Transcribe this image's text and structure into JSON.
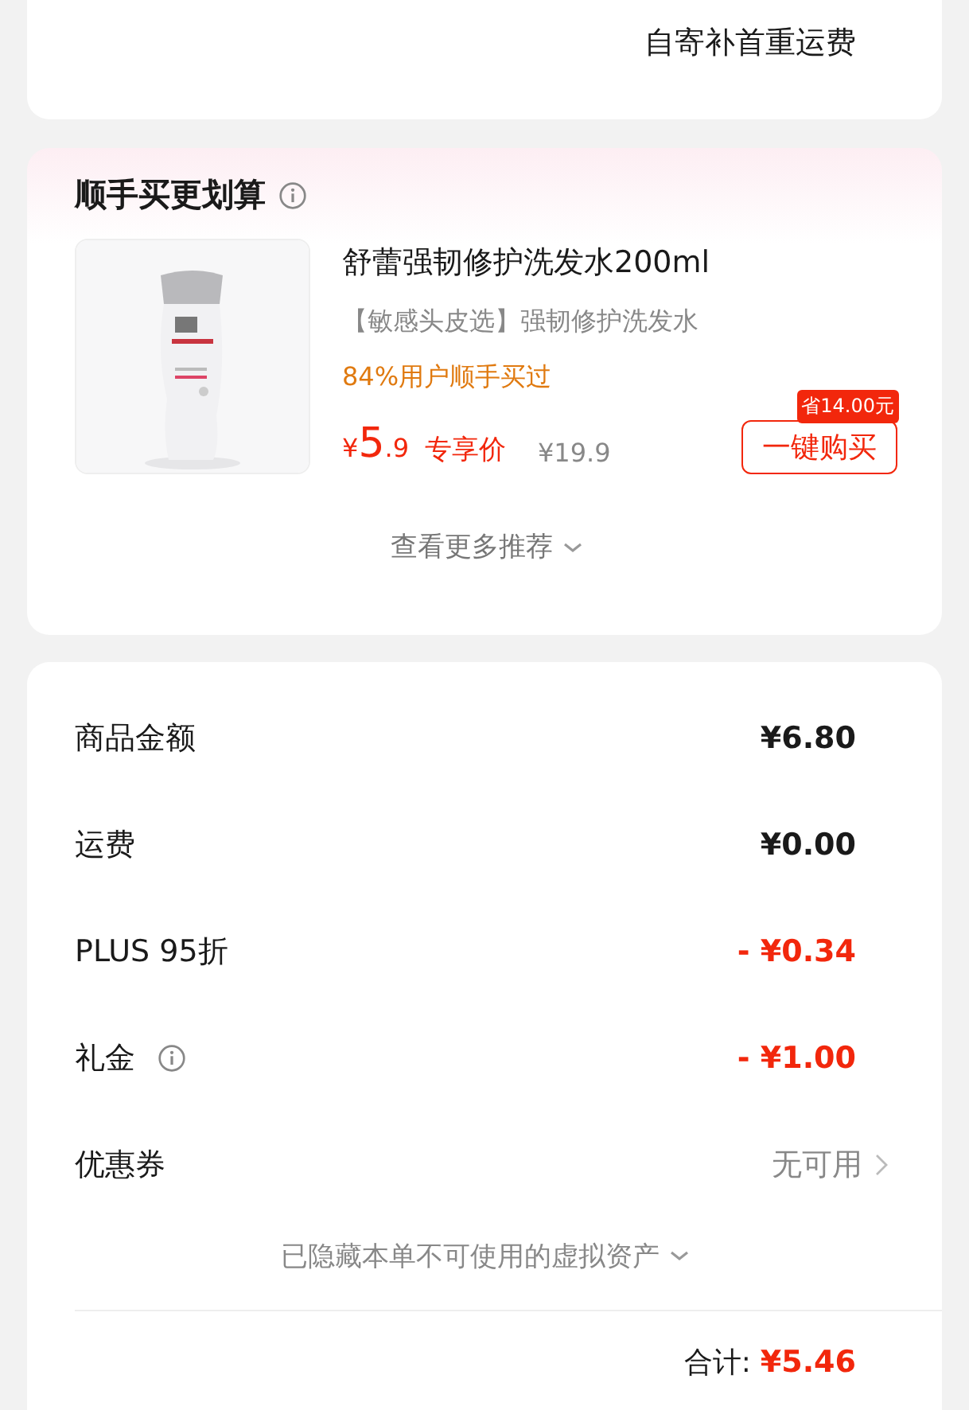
{
  "return_card": {
    "note": "自寄补首重运费"
  },
  "addon": {
    "title": "顺手买更划算",
    "info": true,
    "product": {
      "name": "舒蕾强韧修护洗发水200ml",
      "subtitle": "【敏感头皮选】强韧修护洗发水",
      "social": "84%用户顺手买过",
      "currency": "¥",
      "price_int": "5",
      "price_dec": ".9",
      "price_label": "专享价",
      "original_price": "¥19.9",
      "save_badge": "省14.00元",
      "buy_button": "一键购买"
    },
    "more": "查看更多推荐"
  },
  "summary": {
    "rows": [
      {
        "kind": "amount",
        "label": "商品金额",
        "value": "¥6.80",
        "info": false
      },
      {
        "kind": "amount",
        "label": "运费",
        "value": "¥0.00",
        "info": false
      },
      {
        "kind": "discount",
        "label": "PLUS 95折",
        "value": "- ¥0.34",
        "info": false
      },
      {
        "kind": "discount",
        "label": "礼金",
        "value": "- ¥1.00",
        "info": true
      },
      {
        "kind": "link",
        "label": "优惠券",
        "value": "无可用",
        "info": false
      }
    ],
    "hidden_note": "已隐藏本单不可使用的虚拟资产",
    "total_label": "合计:",
    "total_value": "¥5.46"
  }
}
